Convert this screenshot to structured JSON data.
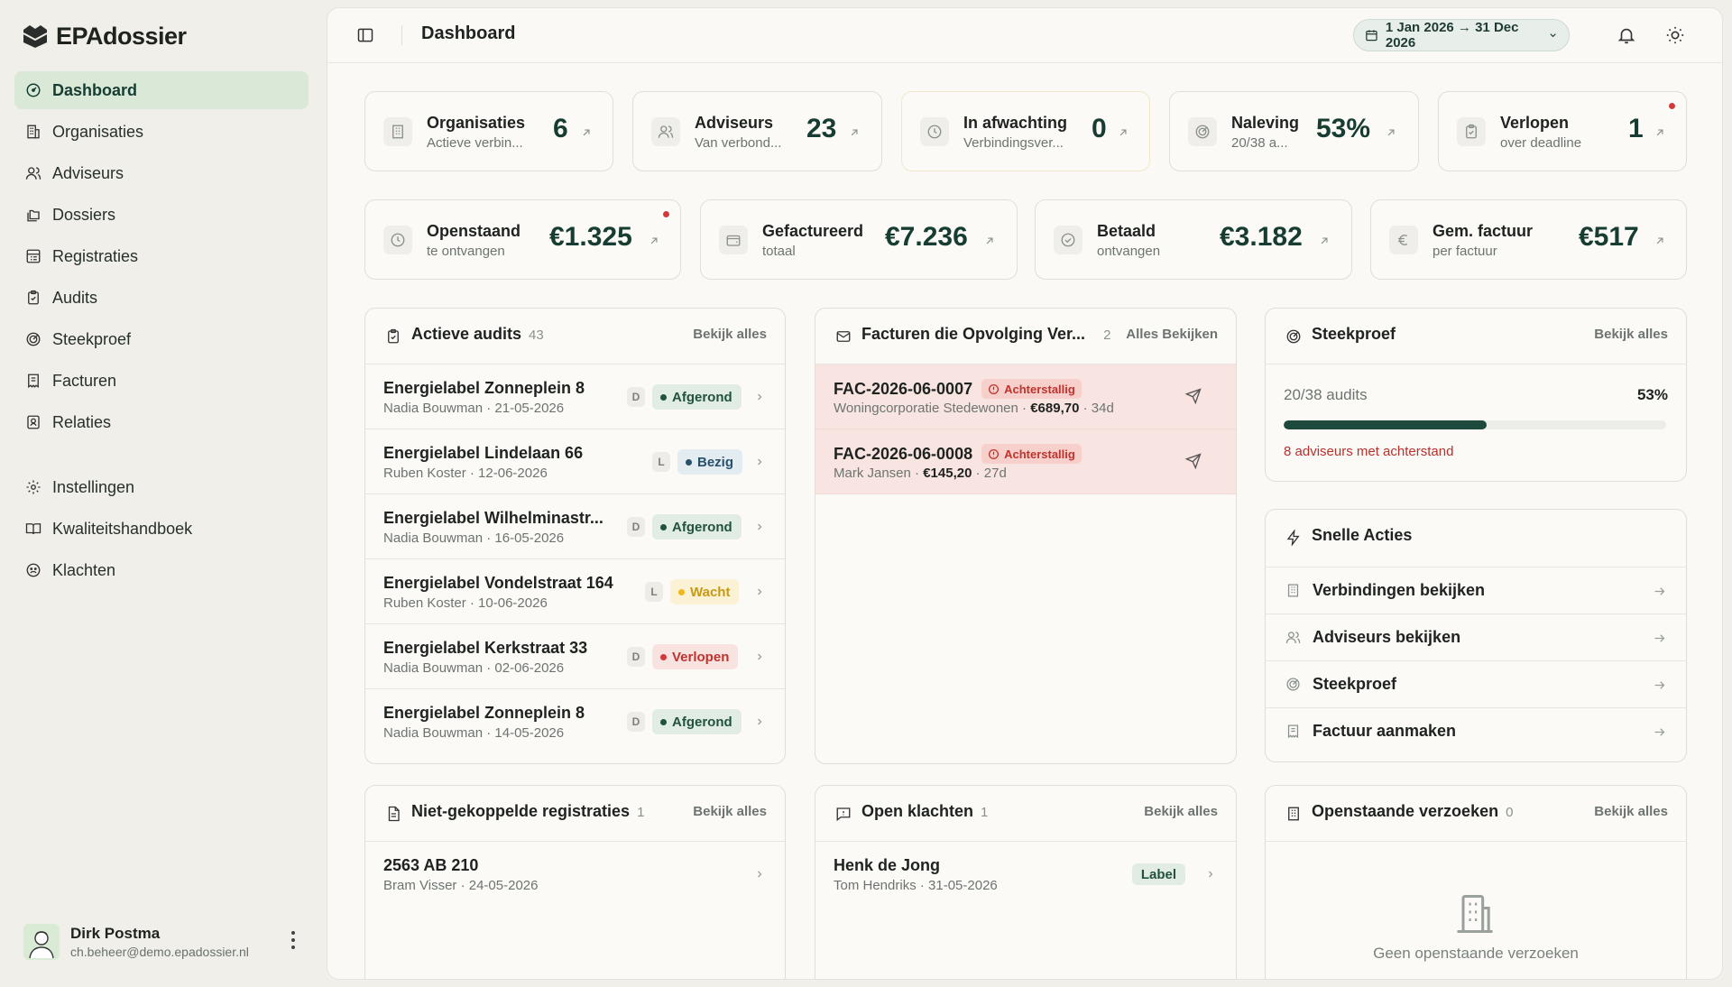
{
  "app": {
    "brand": "EPAdossier",
    "page_title": "Dashboard",
    "date_range": "1 Jan 2026 → 31 Dec 2026"
  },
  "nav": {
    "main": [
      {
        "label": "Dashboard",
        "icon": "gauge-icon",
        "active": true
      },
      {
        "label": "Organisaties",
        "icon": "building-icon"
      },
      {
        "label": "Adviseurs",
        "icon": "users-icon"
      },
      {
        "label": "Dossiers",
        "icon": "folders-icon"
      },
      {
        "label": "Registraties",
        "icon": "registry-icon"
      },
      {
        "label": "Audits",
        "icon": "clipboard-check-icon"
      },
      {
        "label": "Steekproef",
        "icon": "target-icon"
      },
      {
        "label": "Facturen",
        "icon": "receipt-icon"
      },
      {
        "label": "Relaties",
        "icon": "contact-icon"
      }
    ],
    "secondary": [
      {
        "label": "Instellingen",
        "icon": "gear-icon"
      },
      {
        "label": "Kwaliteitshandboek",
        "icon": "book-icon"
      },
      {
        "label": "Klachten",
        "icon": "frown-icon"
      }
    ]
  },
  "user": {
    "name": "Dirk Postma",
    "email": "ch.beheer@demo.epadossier.nl"
  },
  "kpis_row1": [
    {
      "label": "Organisaties",
      "sub": "Actieve verbin...",
      "value": "6"
    },
    {
      "label": "Adviseurs",
      "sub": "Van verbond...",
      "value": "23"
    },
    {
      "label": "In afwachting",
      "sub": "Verbindingsver...",
      "value": "0"
    },
    {
      "label": "Naleving",
      "sub": "20/38 a...",
      "value": "53%"
    },
    {
      "label": "Verlopen",
      "sub": "over deadline",
      "value": "1"
    }
  ],
  "kpis_row2": [
    {
      "label": "Openstaand",
      "sub": "te ontvangen",
      "value": "€1.325"
    },
    {
      "label": "Gefactureerd",
      "sub": "totaal",
      "value": "€7.236"
    },
    {
      "label": "Betaald",
      "sub": "ontvangen",
      "value": "€3.182"
    },
    {
      "label": "Gem. factuur",
      "sub": "per factuur",
      "value": "€517"
    }
  ],
  "audits": {
    "title": "Actieve audits",
    "count": "43",
    "link": "Bekijk alles",
    "rows": [
      {
        "title": "Energielabel Zonneplein 8",
        "sub": "Nadia Bouwman · 21-05-2026",
        "letter": "D",
        "status": "Afgerond"
      },
      {
        "title": "Energielabel Lindelaan 66",
        "sub": "Ruben Koster · 12-06-2026",
        "letter": "L",
        "status": "Bezig"
      },
      {
        "title": "Energielabel Wilhelminastr...",
        "sub": "Nadia Bouwman · 16-05-2026",
        "letter": "D",
        "status": "Afgerond"
      },
      {
        "title": "Energielabel Vondelstraat 164",
        "sub": "Ruben Koster · 10-06-2026",
        "letter": "L",
        "status": "Wacht"
      },
      {
        "title": "Energielabel Kerkstraat 33",
        "sub": "Nadia Bouwman · 02-06-2026",
        "letter": "D",
        "status": "Verlopen"
      },
      {
        "title": "Energielabel Zonneplein 8",
        "sub": "Nadia Bouwman · 14-05-2026",
        "letter": "D",
        "status": "Afgerond"
      }
    ]
  },
  "invoices": {
    "title": "Facturen die Opvolging Ver...",
    "count": "2",
    "link": "Alles Bekijken",
    "rows": [
      {
        "number": "FAC-2026-06-0007",
        "badge": "Achterstallig",
        "client": "Woningcorporatie Stedewonen",
        "amount": "€689,70",
        "age": "34d"
      },
      {
        "number": "FAC-2026-06-0008",
        "badge": "Achterstallig",
        "client": "Mark Jansen",
        "amount": "€145,20",
        "age": "27d"
      }
    ]
  },
  "sample": {
    "title": "Steekproef",
    "link": "Bekijk alles",
    "progress_label": "20/38 audits",
    "progress_pct": "53%",
    "progress_fraction": 0.53,
    "note": "8 adviseurs met achterstand"
  },
  "quick_actions": {
    "title": "Snelle Acties",
    "items": [
      {
        "label": "Verbindingen bekijken",
        "icon": "building-icon"
      },
      {
        "label": "Adviseurs bekijken",
        "icon": "users-icon"
      },
      {
        "label": "Steekproef",
        "icon": "target-icon"
      },
      {
        "label": "Factuur aanmaken",
        "icon": "receipt-icon"
      }
    ]
  },
  "unlinked": {
    "title": "Niet-gekoppelde registraties",
    "count": "1",
    "link": "Bekijk alles",
    "rows": [
      {
        "title": "2563 AB 210",
        "sub": "Bram Visser · 24-05-2026"
      }
    ]
  },
  "complaints": {
    "title": "Open klachten",
    "count": "1",
    "link": "Bekijk alles",
    "rows": [
      {
        "title": "Henk de Jong",
        "sub": "Tom Hendriks · 31-05-2026",
        "chip": "Label"
      }
    ]
  },
  "requests": {
    "title": "Openstaande verzoeken",
    "count": "0",
    "link": "Bekijk alles",
    "empty": "Geen openstaande verzoeken"
  },
  "colors": {
    "accent": "#173d32",
    "active_nav": "#d9e8d7",
    "danger": "#d23a3a",
    "warning": "#f0b818"
  }
}
